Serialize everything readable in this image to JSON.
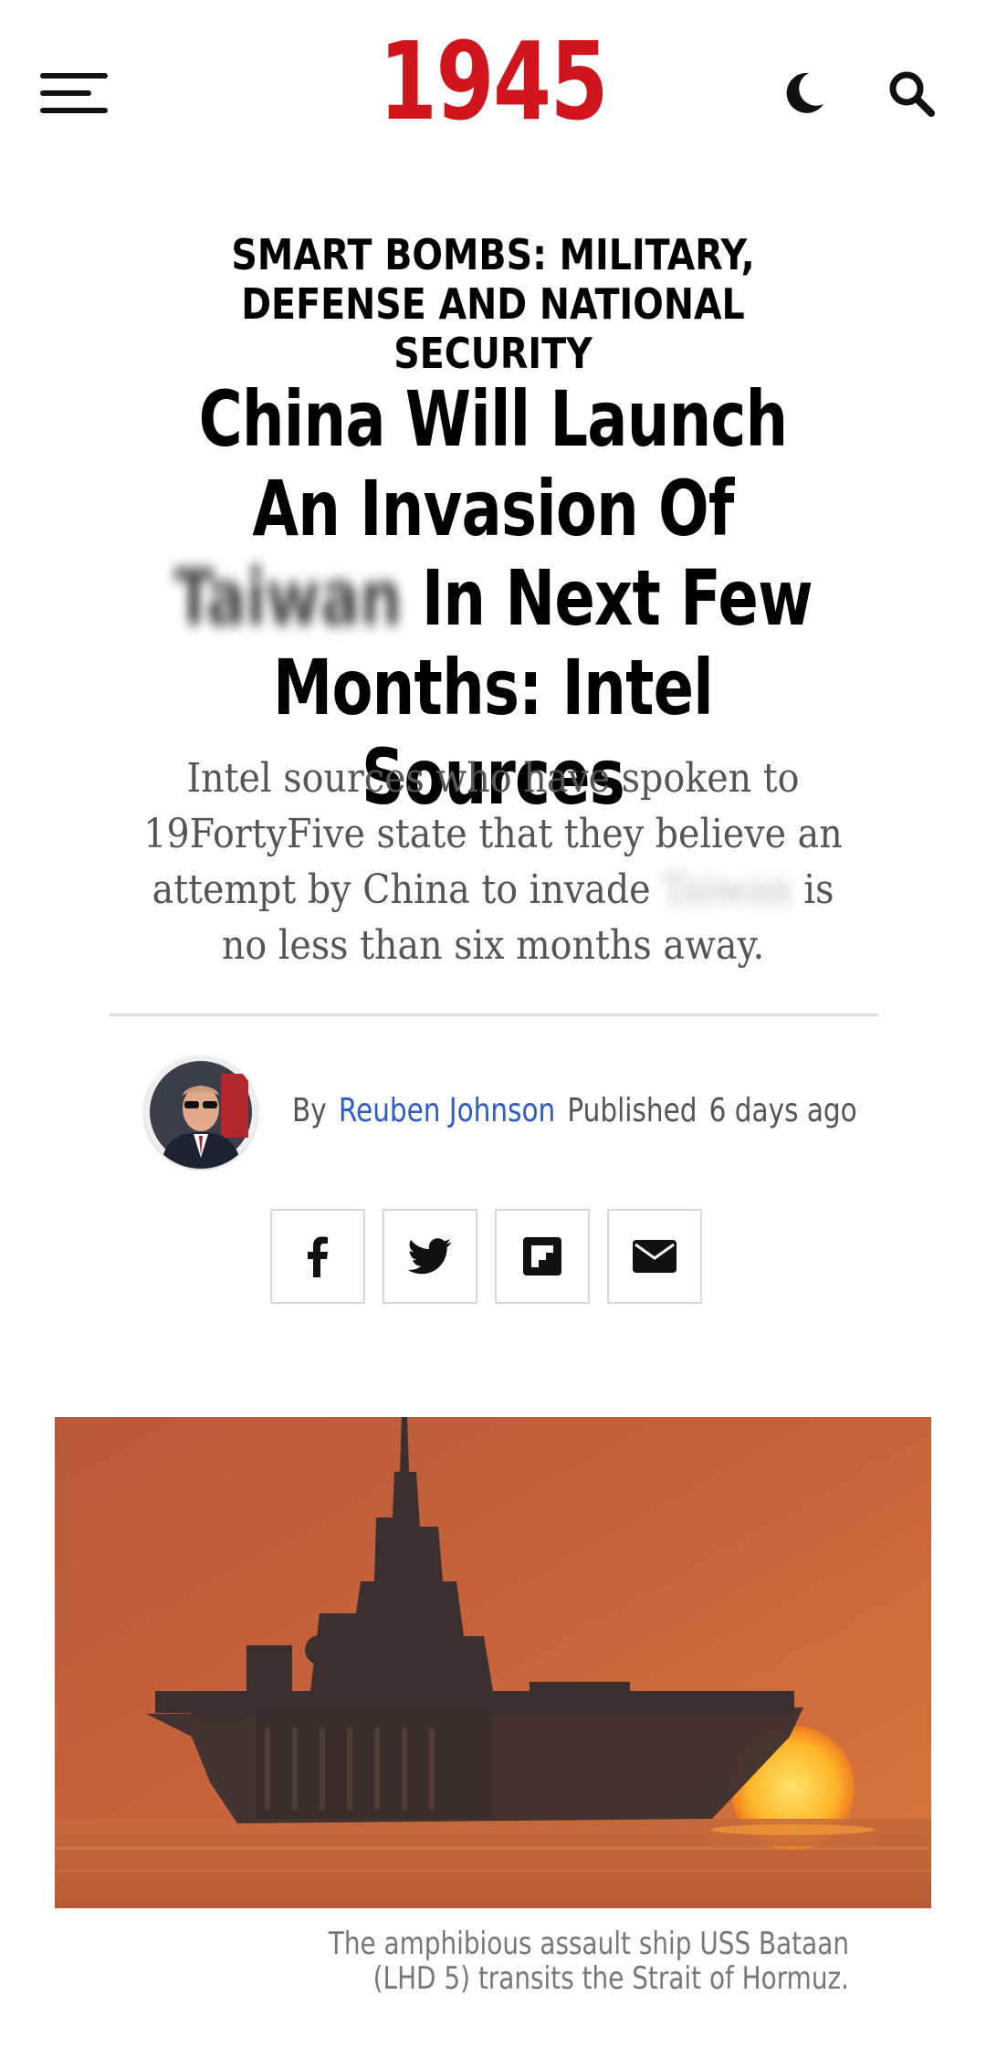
{
  "header": {
    "logo_text": "1945",
    "logo_color": "#d0161c",
    "menu_icon": "hamburger-menu-icon",
    "dark_mode_icon": "moon-icon",
    "search_icon": "search-icon"
  },
  "article": {
    "category": "Smart Bombs: Military, Defense and National Security",
    "title_part1": "China Will Launch An Invasion Of ",
    "title_redacted": "Taiwan",
    "title_part2": " In Next Few Months: Intel Sources",
    "subtitle_part1": "Intel sources who have spoken to 19FortyFive state that they believe an attempt by China to invade ",
    "subtitle_redacted": "Taiwan",
    "subtitle_part2": " is no less than six months away.",
    "byline": {
      "by_label": "By",
      "author": "Reuben Johnson",
      "author_color": "#2d5cc8",
      "published_label": "Published",
      "published_time": "6 days ago"
    },
    "share_buttons": [
      {
        "network": "facebook",
        "icon": "facebook-icon"
      },
      {
        "network": "twitter",
        "icon": "twitter-icon"
      },
      {
        "network": "flipboard",
        "icon": "flipboard-icon"
      },
      {
        "network": "email",
        "icon": "email-icon"
      }
    ],
    "image_caption": "The amphibious assault ship USS Bataan (LHD 5) transits the Strait of Hormuz."
  }
}
